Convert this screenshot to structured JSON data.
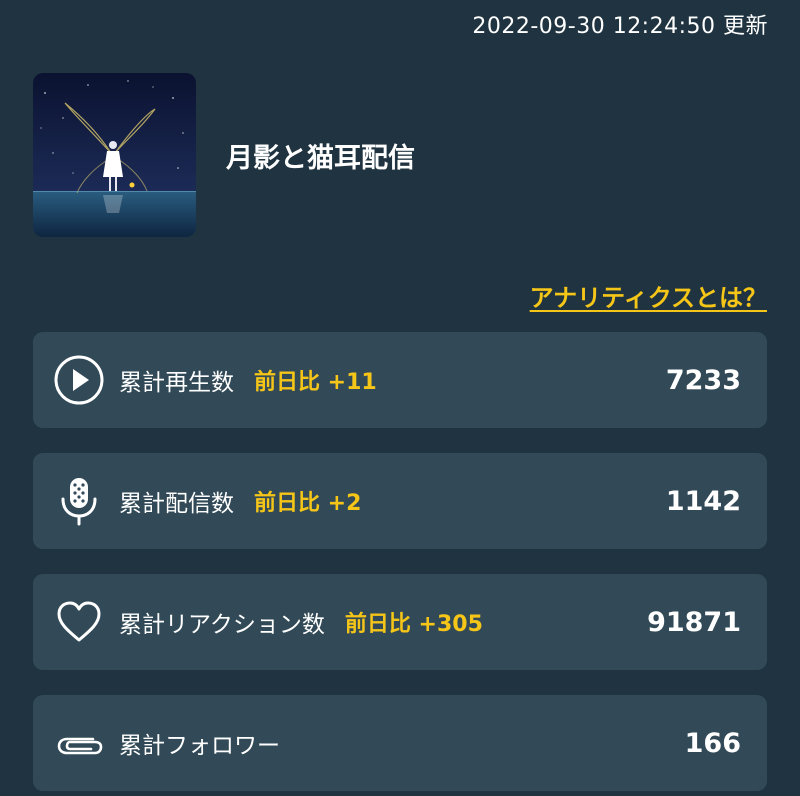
{
  "header": {
    "updated": "2022-09-30 12:24:50 更新"
  },
  "profile": {
    "channel_name": "月影と猫耳配信"
  },
  "help_link": "アナリティクスとは？",
  "colors": {
    "background": "#1f3440",
    "card": "#324a57",
    "accent": "#f5c518"
  },
  "stats": [
    {
      "icon": "play-icon",
      "label": "累計再生数",
      "diff": "前日比 +11",
      "value": "7233"
    },
    {
      "icon": "microphone-icon",
      "label": "累計配信数",
      "diff": "前日比 +2",
      "value": "1142"
    },
    {
      "icon": "heart-icon",
      "label": "累計リアクション数",
      "diff": "前日比 +305",
      "value": "91871"
    },
    {
      "icon": "paperclip-icon",
      "label": "累計フォロワー",
      "diff": "",
      "value": "166"
    }
  ]
}
